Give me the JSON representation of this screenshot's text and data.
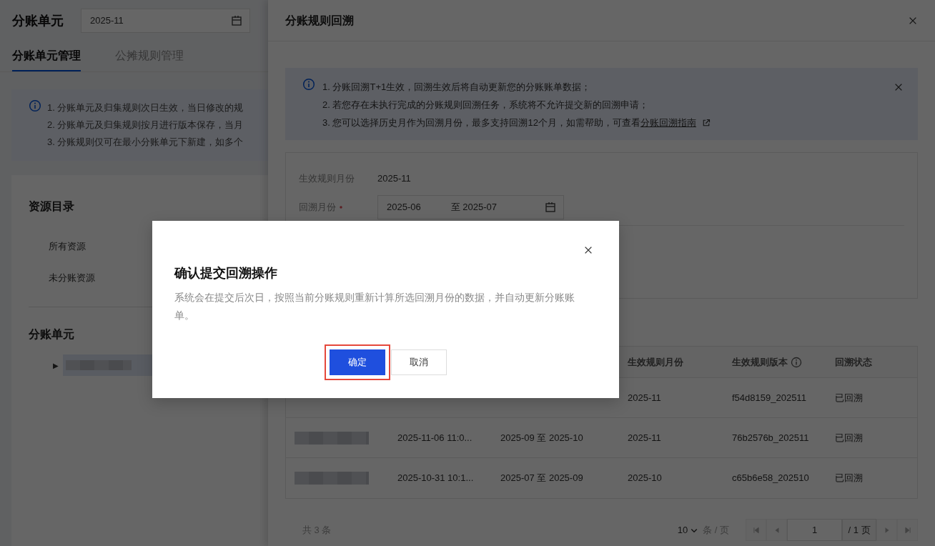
{
  "page": {
    "title": "分账单元",
    "month_picker": {
      "value": "2025-11"
    },
    "tabs": [
      {
        "label": "分账单元管理",
        "selected": true
      },
      {
        "label": "公摊规则管理",
        "selected": false
      }
    ],
    "notice": [
      "1. 分账单元及归集规则次日生效，当日修改的规",
      "2. 分账单元及归集规则按月进行版本保存，当月",
      "3. 分账规则仅可在最小分账单元下新建，如多个"
    ],
    "resource_catalog": {
      "title": "资源目录",
      "items": [
        "所有资源",
        "未分账资源"
      ]
    },
    "units": {
      "title": "分账单元",
      "items": [
        {
          "toggle": "▶",
          "selected": true,
          "expanded": false
        }
      ]
    }
  },
  "drawer": {
    "title": "分账规则回溯",
    "notice": {
      "lines": [
        "1. 分账回溯T+1生效，回溯生效后将自动更新您的分账账单数据；",
        "2. 若您存在未执行完成的分账规则回溯任务，系统将不允许提交新的回溯申请；",
        "3. 您可以选择历史月作为回溯月份，最多支持回溯12个月，如需帮助，可查看"
      ],
      "link": "分账回溯指南"
    },
    "form": {
      "rule_month": {
        "label": "生效规则月份",
        "value": "2025-11"
      },
      "backtrack_month": {
        "label": "回溯月份",
        "required": true,
        "start": "2025-06",
        "separator": "至",
        "end": "2025-07"
      }
    },
    "table": {
      "columns": [
        null,
        null,
        null,
        {
          "label": "生效规则月份"
        },
        {
          "label": "生效规则版本",
          "info": true
        },
        {
          "label": "回溯状态"
        }
      ],
      "rows": [
        {
          "cells": [
            null,
            null,
            null,
            "2025-11",
            "f54d8159_202511",
            "已回溯"
          ]
        },
        {
          "cells": [
            {
              "kind": "redacted"
            },
            "2025-11-06 11:0...",
            "2025-09 至 2025-10",
            "2025-11",
            "76b2576b_202511",
            "已回溯"
          ]
        },
        {
          "cells": [
            {
              "kind": "redacted"
            },
            "2025-10-31 10:1...",
            "2025-07 至 2025-09",
            "2025-10",
            "c65b6e58_202510",
            "已回溯"
          ]
        }
      ]
    },
    "pagination": {
      "total": "共 3 条",
      "page_size": "10",
      "page_size_unit": "条 / 页",
      "page": "1",
      "page_count": "/ 1 页",
      "first_disabled": true,
      "prev_disabled": true,
      "next_disabled": true,
      "last_disabled": true
    }
  },
  "modal": {
    "title": "确认提交回溯操作",
    "body": "系统会在提交后次日，按照当前分账规则重新计算所选回溯月份的数据，并自动更新分账账单。",
    "buttons": [
      {
        "label": "确定",
        "kind": "primary",
        "highlighted": true
      },
      {
        "label": "取消",
        "kind": "secondary",
        "highlighted": false
      }
    ]
  }
}
